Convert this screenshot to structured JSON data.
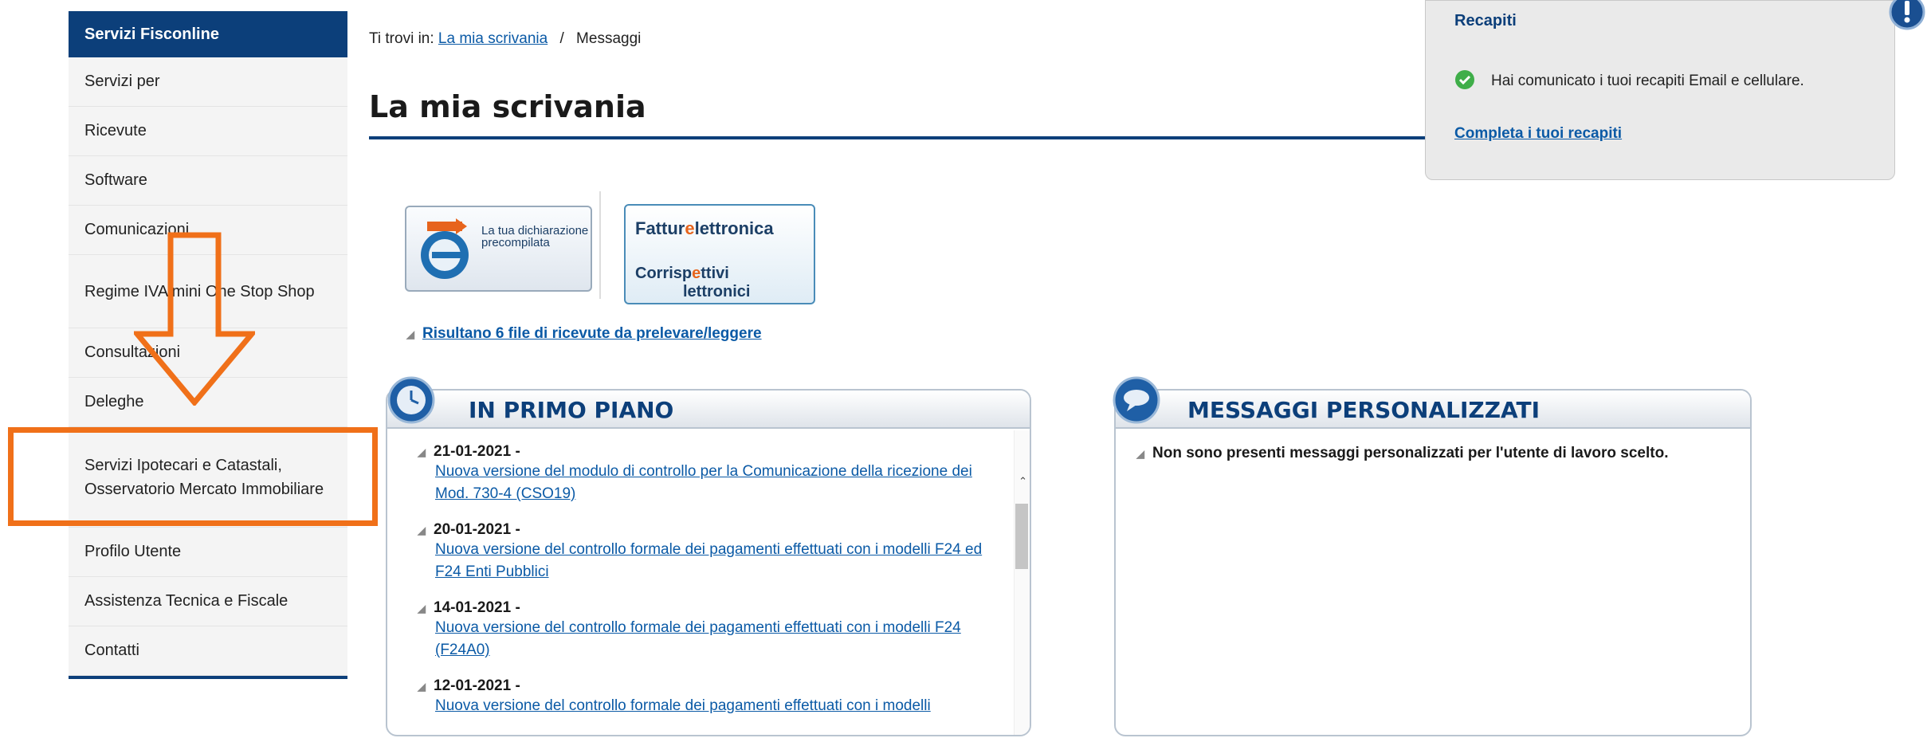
{
  "sidebar": {
    "header": "Servizi Fisconline",
    "items": [
      {
        "label": "Servizi per"
      },
      {
        "label": "Ricevute"
      },
      {
        "label": "Software"
      },
      {
        "label": "Comunicazioni"
      },
      {
        "label": "Regime IVA mini One Stop Shop"
      },
      {
        "label": "Consultazioni"
      },
      {
        "label": "Deleghe"
      },
      {
        "label": "Servizi Ipotecari e Catastali, Osservatorio Mercato Immobiliare"
      },
      {
        "label": "Profilo Utente"
      },
      {
        "label": "Assistenza Tecnica e Fiscale"
      },
      {
        "label": "Contatti"
      }
    ]
  },
  "annotation": {
    "color": "#f07019"
  },
  "breadcrumb": {
    "prefix": "Ti trovi in:",
    "link": "La mia scrivania",
    "separator": "/",
    "current": "Messaggi"
  },
  "page": {
    "title": "La mia scrivania"
  },
  "banners": {
    "precompilata": "La tua dichiarazione precompilata",
    "fattura_a": "Fattur",
    "fattura_b": "lettronica",
    "corrisp_a": "Corrisp",
    "corrisp_b": "ttivi",
    "corrisp_c": "lettronici"
  },
  "receipts_link": "Risultano 6 file di ricevute da prelevare/leggere",
  "in_primo_piano": {
    "title": "IN PRIMO PIANO",
    "items": [
      {
        "date": "21-01-2021 -",
        "link": "Nuova versione del modulo di controllo per la Comunicazione della ricezione dei Mod. 730-4 (CSO19)"
      },
      {
        "date": "20-01-2021 -",
        "link": "Nuova versione del controllo formale dei pagamenti effettuati con i modelli F24 ed F24 Enti Pubblici"
      },
      {
        "date": "14-01-2021 -",
        "link": "Nuova versione del controllo formale dei pagamenti effettuati con i modelli F24 (F24A0)"
      },
      {
        "date": "12-01-2021 -",
        "link": "Nuova versione del controllo formale dei pagamenti effettuati con i modelli"
      }
    ]
  },
  "messaggi": {
    "title": "MESSAGGI PERSONALIZZATI",
    "text": "Non sono presenti messaggi personalizzati per l'utente di lavoro scelto."
  },
  "recapiti": {
    "title": "Recapiti",
    "message": "Hai comunicato i tuoi recapiti Email e cellulare.",
    "link": "Completa i tuoi recapiti"
  },
  "colors": {
    "brand": "#0c3f7a",
    "link": "#0b5aa6",
    "annotation": "#f07019",
    "success": "#3fae49"
  }
}
